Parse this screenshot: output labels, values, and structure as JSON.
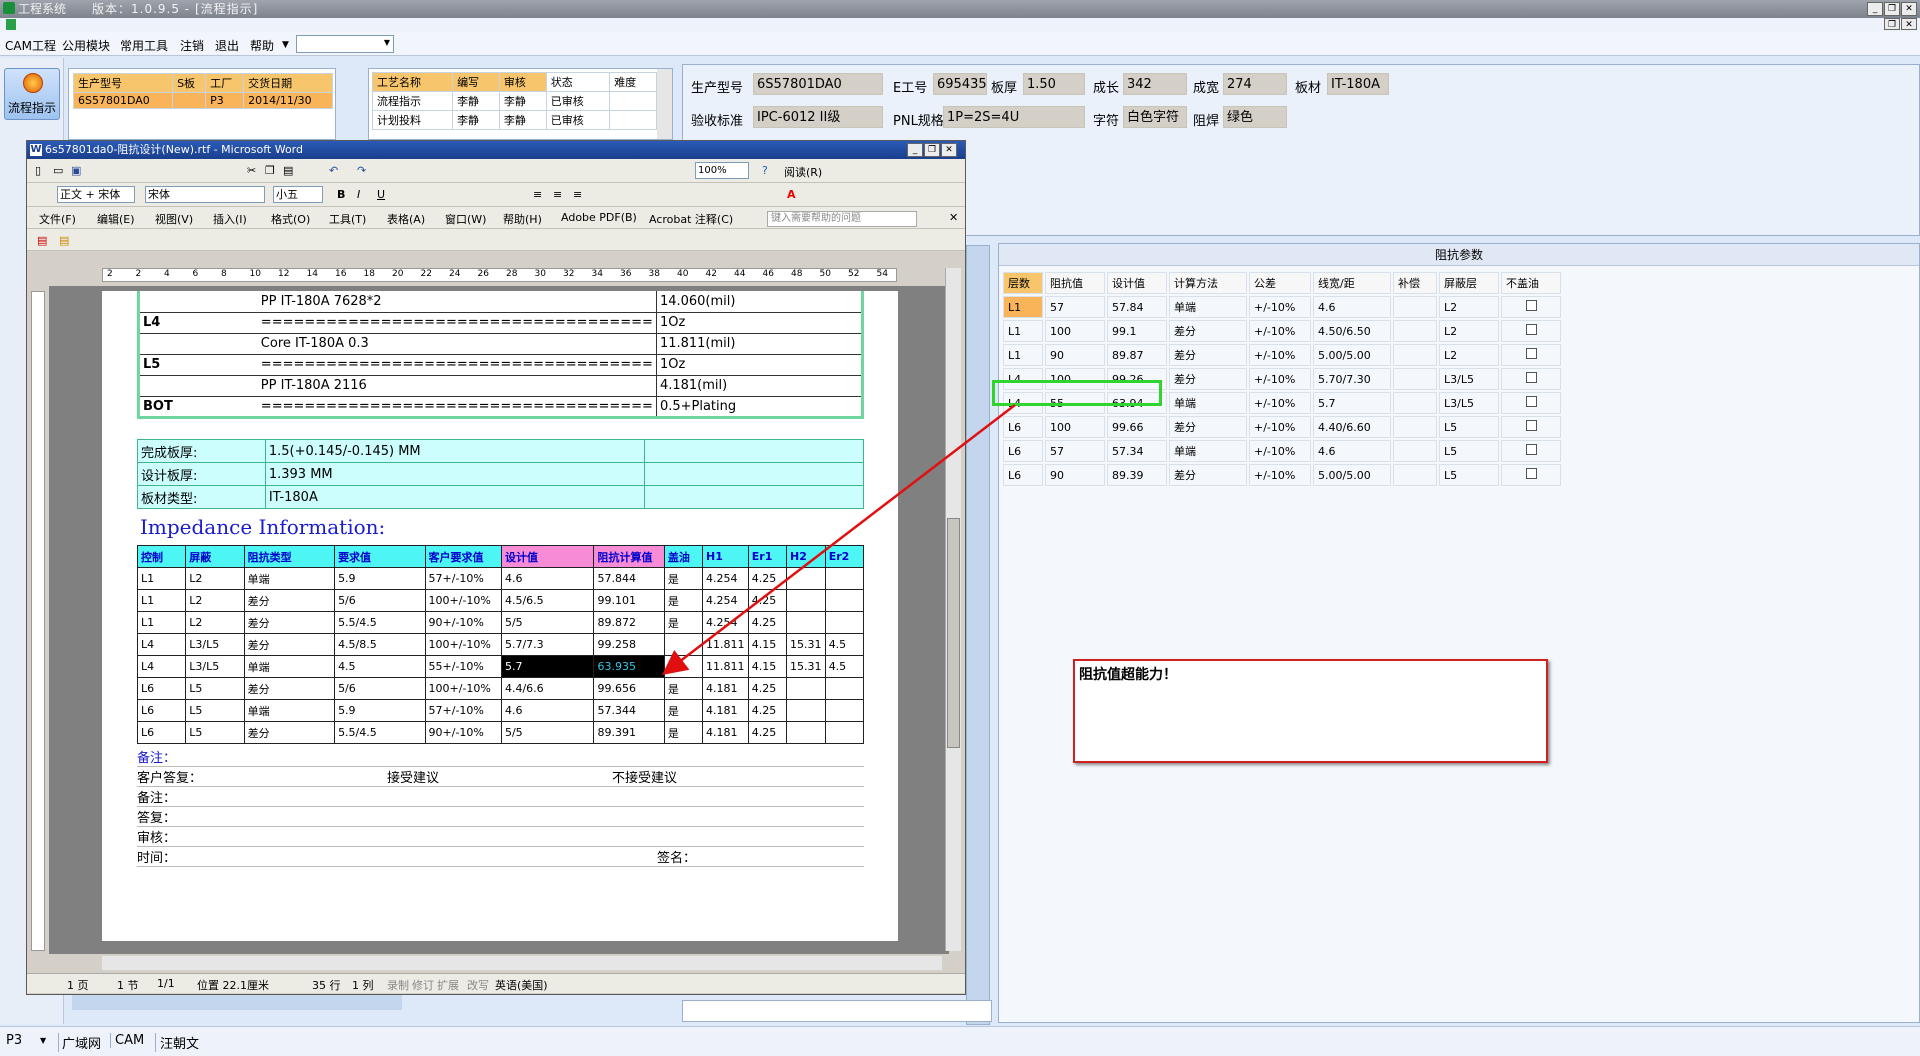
{
  "app": {
    "title": "工程系统",
    "version": "版本：1.0.9.5 - [流程指示]"
  },
  "menu": [
    "CAM工程",
    "公用模块",
    "常用工具",
    "注销",
    "退出",
    "帮助"
  ],
  "left_nav": {
    "label": "流程指示"
  },
  "job_table": {
    "headers": [
      "生产型号",
      "S板",
      "工厂",
      "交货日期"
    ],
    "rows": [
      [
        "6S57801DA0",
        "",
        "P3",
        "2014/11/30"
      ]
    ]
  },
  "process_table": {
    "headers": [
      "工艺名称",
      "编写",
      "审核",
      "状态",
      "难度"
    ],
    "rows": [
      [
        "流程指示",
        "李静",
        "李静",
        "已审核",
        ""
      ],
      [
        "计划投料",
        "李静",
        "李静",
        "已审核",
        ""
      ]
    ]
  },
  "info": {
    "生产型号": "6S57801DA0",
    "E工号": "695435",
    "板厚": "1.50",
    "成长": "342",
    "成宽": "274",
    "板材": "IT-180A",
    "验收标准": "IPC-6012 II级",
    "PNL规格": "1P=2S=4U",
    "字符": "白色字符",
    "阻焊": "绿色"
  },
  "word": {
    "title": "6s57801da0-阻抗设计(New).rtf - Microsoft Word",
    "zoom": "100%",
    "read": "阅读(R)",
    "style": "正文 + 宋体",
    "font": "宋体",
    "size": "小五",
    "menu": [
      "文件(F)",
      "编辑(E)",
      "视图(V)",
      "插入(I)",
      "格式(O)",
      "工具(T)",
      "表格(A)",
      "窗口(W)",
      "帮助(H)",
      "Adobe PDF(B)",
      "Acrobat 注释(C)"
    ],
    "help_placeholder": "键入需要帮助的问题",
    "ruler": [
      "2",
      "2",
      "4",
      "6",
      "8",
      "10",
      "12",
      "14",
      "16",
      "18",
      "20",
      "22",
      "24",
      "26",
      "28",
      "30",
      "32",
      "34",
      "36",
      "38",
      "40",
      "42",
      "44",
      "46",
      "48",
      "50",
      "52",
      "54"
    ],
    "stack": [
      [
        "",
        "PP    IT-180A   7628*2",
        "14.060(mil)"
      ],
      [
        "L4",
        "====================================",
        "1Oz"
      ],
      [
        "",
        "Core    IT-180A    0.3",
        "11.811(mil)"
      ],
      [
        "L5",
        "====================================",
        "1Oz"
      ],
      [
        "",
        "PP    IT-180A    2116",
        "4.181(mil)"
      ],
      [
        "BOT",
        "====================================",
        "0.5+Plating"
      ]
    ],
    "thickness": [
      [
        "完成板厚:",
        "1.5(+0.145/-0.145) MM",
        ""
      ],
      [
        "设计板厚:",
        "1.393 MM",
        ""
      ],
      [
        "板材类型:",
        "IT-180A",
        ""
      ]
    ],
    "impedance_title": "Impedance Information:",
    "imp_headers": [
      "控制",
      "屏蔽",
      "阻抗类型",
      "要求值",
      "客户要求值",
      "设计值",
      "阻抗计算值",
      "盖油",
      "H1",
      "Er1",
      "H2",
      "Er2"
    ],
    "imp_rows": [
      [
        "L1",
        "L2",
        "单端",
        "5.9",
        "57+/-10%",
        "4.6",
        "57.844",
        "是",
        "4.254",
        "4.25",
        "",
        ""
      ],
      [
        "L1",
        "L2",
        "差分",
        "5/6",
        "100+/-10%",
        "4.5/6.5",
        "99.101",
        "是",
        "4.254",
        "4.25",
        "",
        ""
      ],
      [
        "L1",
        "L2",
        "差分",
        "5.5/4.5",
        "90+/-10%",
        "5/5",
        "89.872",
        "是",
        "4.254",
        "4.25",
        "",
        ""
      ],
      [
        "L4",
        "L3/L5",
        "差分",
        "4.5/8.5",
        "100+/-10%",
        "5.7/7.3",
        "99.258",
        "",
        "11.811",
        "4.15",
        "15.31",
        "4.5"
      ],
      [
        "L4",
        "L3/L5",
        "单端",
        "4.5",
        "55+/-10%",
        "5.7",
        "63.935",
        "",
        "11.811",
        "4.15",
        "15.31",
        "4.5"
      ],
      [
        "L6",
        "L5",
        "差分",
        "5/6",
        "100+/-10%",
        "4.4/6.6",
        "99.656",
        "是",
        "4.181",
        "4.25",
        "",
        ""
      ],
      [
        "L6",
        "L5",
        "单端",
        "5.9",
        "57+/-10%",
        "4.6",
        "57.344",
        "是",
        "4.181",
        "4.25",
        "",
        ""
      ],
      [
        "L6",
        "L5",
        "差分",
        "5.5/4.5",
        "90+/-10%",
        "5/5",
        "89.391",
        "是",
        "4.181",
        "4.25",
        "",
        ""
      ]
    ],
    "bottom": {
      "备注1": "备注：",
      "客户答复": "客户答复：",
      "接受": "接受建议",
      "不接受": "不接受建议",
      "备注2": "备注：",
      "答复": "答复：",
      "审核": "审核：",
      "时间": "时间：",
      "签名": "签名："
    },
    "status": [
      "1 页",
      "1 节",
      "1/1",
      "位置 22.1厘米",
      "35 行",
      "1 列",
      "录制",
      "修订",
      "扩展",
      "改写",
      "英语(美国)"
    ]
  },
  "impedance_panel": {
    "title": "阻抗参数",
    "headers": [
      "层数",
      "阻抗值",
      "设计值",
      "计算方法",
      "公差",
      "线宽/距",
      "补偿",
      "屏蔽层",
      "不盖油"
    ],
    "rows": [
      [
        "L1",
        "57",
        "57.84",
        "单端",
        "+/-10%",
        "4.6",
        "",
        "L2"
      ],
      [
        "L1",
        "100",
        "99.1",
        "差分",
        "+/-10%",
        "4.50/6.50",
        "",
        "L2"
      ],
      [
        "L1",
        "90",
        "89.87",
        "差分",
        "+/-10%",
        "5.00/5.00",
        "",
        "L2"
      ],
      [
        "L4",
        "100",
        "99.26",
        "差分",
        "+/-10%",
        "5.70/7.30",
        "",
        "L3/L5"
      ],
      [
        "L4",
        "55",
        "63.94",
        "单端",
        "+/-10%",
        "5.7",
        "",
        "L3/L5"
      ],
      [
        "L6",
        "100",
        "99.66",
        "差分",
        "+/-10%",
        "4.40/6.60",
        "",
        "L5"
      ],
      [
        "L6",
        "57",
        "57.34",
        "单端",
        "+/-10%",
        "4.6",
        "",
        "L5"
      ],
      [
        "L6",
        "90",
        "89.39",
        "差分",
        "+/-10%",
        "5.00/5.00",
        "",
        "L5"
      ]
    ]
  },
  "annotation": "阻抗值超能力！",
  "statusbar": {
    "factory": "P3",
    "items": [
      "广域网",
      "CAM",
      "汪朝文"
    ]
  },
  "colors": {
    "highlight_green": "#2fd42f",
    "annotation_red": "#e01010"
  }
}
